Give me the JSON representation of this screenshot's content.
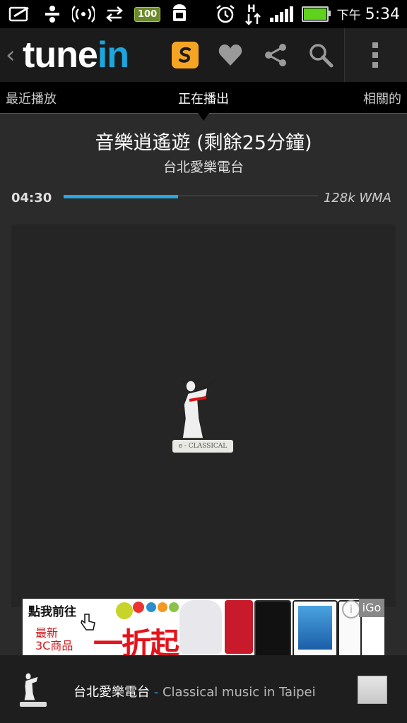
{
  "status_bar": {
    "battery_badge": "100",
    "ampm": "下午",
    "time": "5:34",
    "network": "H"
  },
  "app_bar": {
    "logo_main": "tune",
    "logo_accent": "in",
    "icons": [
      "back-icon",
      "soundhound-icon",
      "heart-icon",
      "share-icon",
      "search-icon",
      "overflow-menu-icon"
    ],
    "accent_color": "#1ba6de",
    "soundhound_color": "#f5a523"
  },
  "tabs": {
    "left": "最近播放",
    "center": "正在播出",
    "right": "相關的"
  },
  "now_playing": {
    "title": "音樂逍遙遊 (剩餘25分鐘)",
    "station": "台北愛樂電台",
    "elapsed": "04:30",
    "progress": 0.45,
    "bitrate": "128k  WMA"
  },
  "artwork": {
    "caption": "e - CLASSICAL"
  },
  "ad": {
    "cta": "點我前往",
    "new_line1": "最新",
    "new_line2": "3C商品",
    "discount": "一折起",
    "igo": "iGo"
  },
  "mini_player": {
    "station": "台北愛樂電台",
    "separator": " - ",
    "genre": "Classical music in Taipei"
  }
}
